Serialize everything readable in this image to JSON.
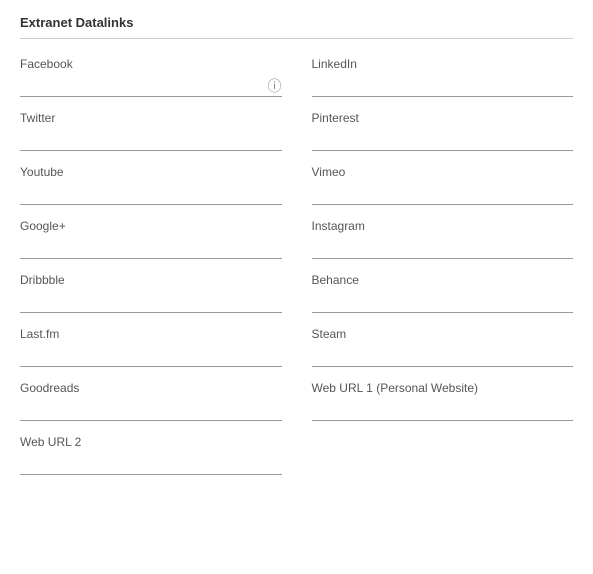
{
  "section": {
    "title": "Extranet Datalinks"
  },
  "fields": [
    {
      "id": "facebook",
      "label": "Facebook",
      "value": "",
      "placeholder": "",
      "has_info_icon": true,
      "col": 1
    },
    {
      "id": "linkedin",
      "label": "LinkedIn",
      "value": "",
      "placeholder": "",
      "has_info_icon": false,
      "col": 2
    },
    {
      "id": "twitter",
      "label": "Twitter",
      "value": "",
      "placeholder": "",
      "has_info_icon": false,
      "col": 1
    },
    {
      "id": "pinterest",
      "label": "Pinterest",
      "value": "",
      "placeholder": "",
      "has_info_icon": false,
      "col": 2
    },
    {
      "id": "youtube",
      "label": "Youtube",
      "value": "",
      "placeholder": "",
      "has_info_icon": false,
      "col": 1
    },
    {
      "id": "vimeo",
      "label": "Vimeo",
      "value": "",
      "placeholder": "",
      "has_info_icon": false,
      "col": 2
    },
    {
      "id": "googleplus",
      "label": "Google+",
      "value": "",
      "placeholder": "",
      "has_info_icon": false,
      "col": 1
    },
    {
      "id": "instagram",
      "label": "Instagram",
      "value": "",
      "placeholder": "",
      "has_info_icon": false,
      "col": 2
    },
    {
      "id": "dribbble",
      "label": "Dribbble",
      "value": "",
      "placeholder": "",
      "has_info_icon": false,
      "col": 1
    },
    {
      "id": "behance",
      "label": "Behance",
      "value": "",
      "placeholder": "",
      "has_info_icon": false,
      "col": 2
    },
    {
      "id": "lastfm",
      "label": "Last.fm",
      "value": "",
      "placeholder": "",
      "has_info_icon": false,
      "col": 1
    },
    {
      "id": "steam",
      "label": "Steam",
      "value": "",
      "placeholder": "",
      "has_info_icon": false,
      "col": 2
    },
    {
      "id": "goodreads",
      "label": "Goodreads",
      "value": "",
      "placeholder": "",
      "has_info_icon": false,
      "col": 1
    },
    {
      "id": "weburl1",
      "label": "Web URL 1 (Personal Website)",
      "value": "",
      "placeholder": "",
      "has_info_icon": false,
      "col": 2
    },
    {
      "id": "weburl2",
      "label": "Web URL 2",
      "value": "",
      "placeholder": "",
      "has_info_icon": false,
      "col": 1
    }
  ],
  "icons": {
    "info": "ⓘ"
  }
}
